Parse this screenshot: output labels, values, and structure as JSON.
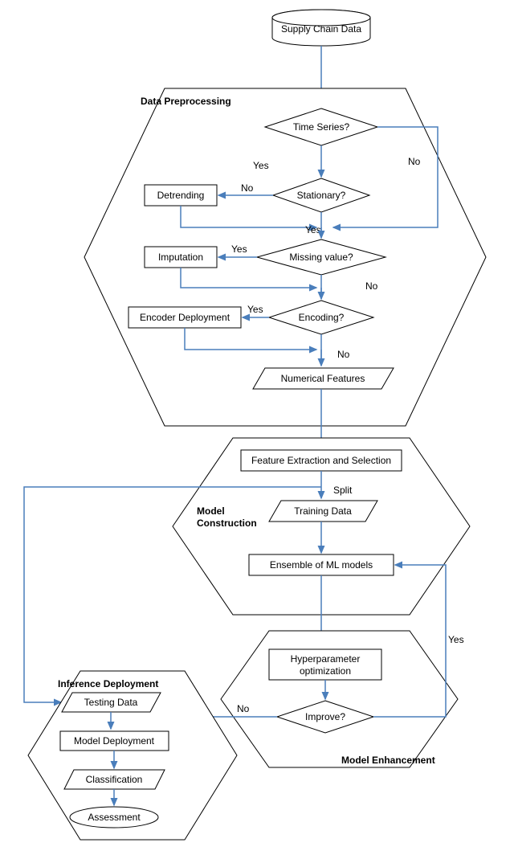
{
  "start": {
    "label": "Supply Chain Data"
  },
  "stage1": {
    "title": "Data Preprocessing",
    "d1": {
      "label": "Time Series?",
      "yes": "Yes",
      "no": "No"
    },
    "d2": {
      "label": "Stationary?",
      "yes": "Yes",
      "no": "No"
    },
    "p1": {
      "label": "Detrending"
    },
    "d3": {
      "label": "Missing value?",
      "yes": "Yes",
      "no": "No"
    },
    "p2": {
      "label": "Imputation"
    },
    "d4": {
      "label": "Encoding?",
      "yes": "Yes",
      "no": "No"
    },
    "p3": {
      "label": "Encoder Deployment"
    },
    "out": {
      "label": "Numerical Features"
    }
  },
  "stage2": {
    "title_l1": "Model",
    "title_l2": "Construction",
    "p1": {
      "label": "Feature Extraction and Selection"
    },
    "split": "Split",
    "p2": {
      "label": "Training Data"
    },
    "p3": {
      "label": "Ensemble of ML models"
    }
  },
  "stage3": {
    "title": "Model Enhancement",
    "p1_l1": "Hyperparameter",
    "p1_l2": "optimization",
    "d1": {
      "label": "Improve?",
      "yes": "Yes",
      "no": "No"
    }
  },
  "stage4": {
    "title": "Inference Deployment",
    "p1": {
      "label": "Testing Data"
    },
    "p2": {
      "label": "Model Deployment"
    },
    "p3": {
      "label": "Classification"
    },
    "p4": {
      "label": "Assessment"
    }
  }
}
